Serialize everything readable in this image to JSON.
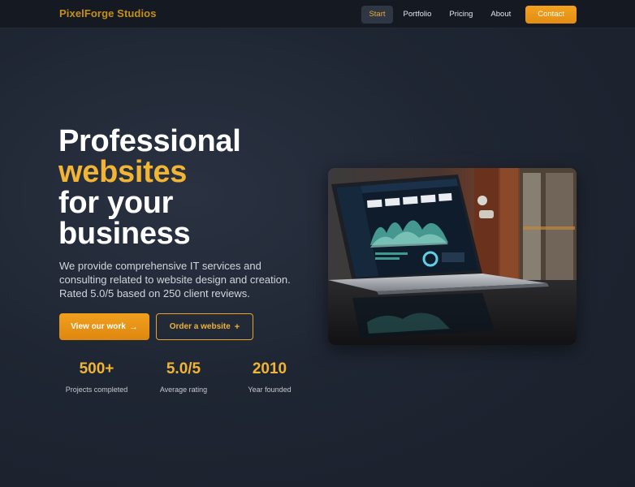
{
  "header": {
    "brand": "PixelForge Studios",
    "nav": [
      {
        "label": "Start",
        "active": true
      },
      {
        "label": "Portfolio"
      },
      {
        "label": "Pricing"
      },
      {
        "label": "About"
      }
    ],
    "cta_label": "Contact"
  },
  "hero": {
    "title_line1": "Professional",
    "title_accent": "websites",
    "title_line3": "for your",
    "title_line4": "business",
    "subtitle": "We provide comprehensive IT services and consulting related to website design and creation. Rated 5.0/5 based on 250 client reviews.",
    "primary_button": "View our work",
    "secondary_button": "Order a website",
    "image_icon": "laptop-analytics-photo"
  },
  "stats": [
    {
      "value": "500+",
      "label": "Projects completed"
    },
    {
      "value": "5.0/5",
      "label": "Average rating"
    },
    {
      "value": "2010",
      "label": "Year founded"
    }
  ],
  "colors": {
    "accent": "#f2b533",
    "button": "#e99515",
    "background": "#1f2633",
    "header": "#151a22"
  }
}
